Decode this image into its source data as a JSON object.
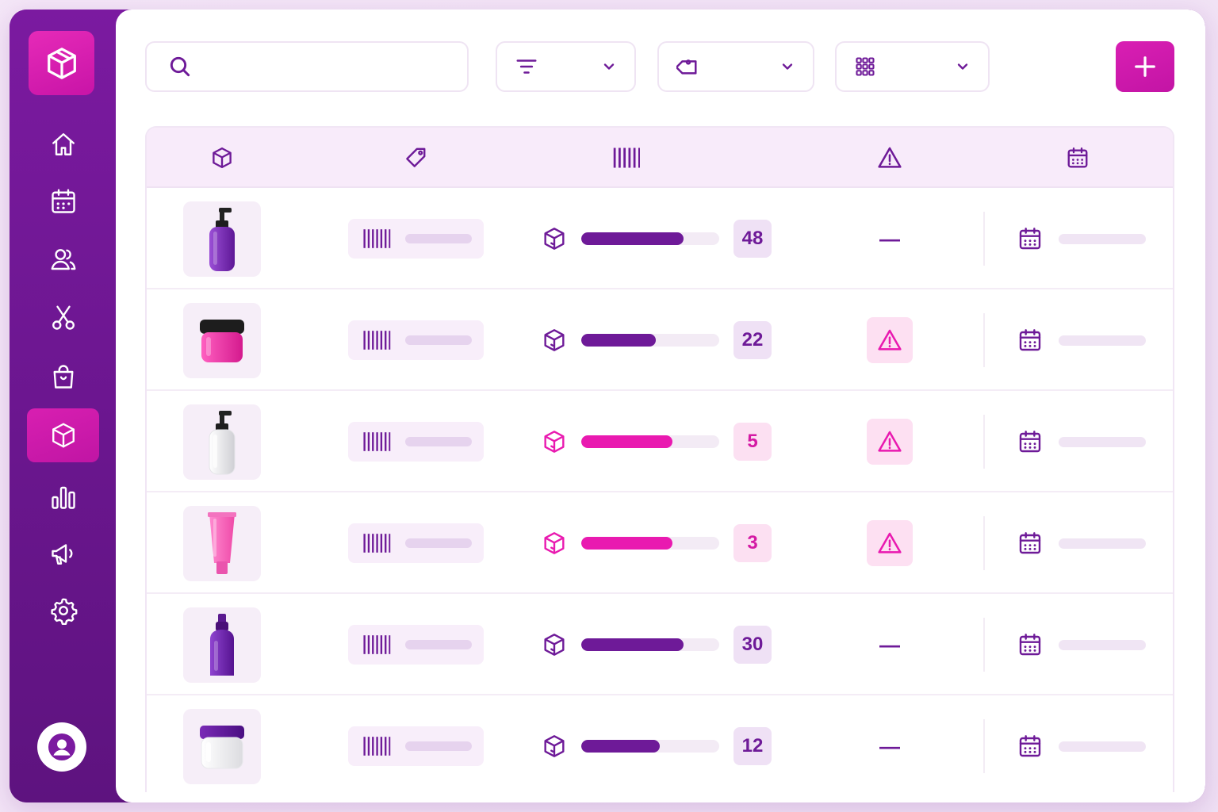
{
  "theme": {
    "primary": "#7b1aa0",
    "accent": "#d81fb1",
    "low_stock": "#e91ab0",
    "ok_stock": "#6e1a98"
  },
  "sidebar": {
    "logo_icon": "box-icon",
    "items": [
      {
        "name": "home",
        "icon": "home-icon",
        "active": false
      },
      {
        "name": "calendar",
        "icon": "calendar-icon",
        "active": false
      },
      {
        "name": "clients",
        "icon": "users-icon",
        "active": false
      },
      {
        "name": "services",
        "icon": "scissors-icon",
        "active": false
      },
      {
        "name": "shop",
        "icon": "shopping-bag-icon",
        "active": false
      },
      {
        "name": "inventory",
        "icon": "box-icon",
        "active": true
      },
      {
        "name": "reports",
        "icon": "bar-chart-icon",
        "active": false
      },
      {
        "name": "marketing",
        "icon": "megaphone-icon",
        "active": false
      },
      {
        "name": "settings",
        "icon": "gear-icon",
        "active": false
      }
    ],
    "avatar_icon": "user-icon"
  },
  "toolbar": {
    "search": {
      "value": "",
      "placeholder": "",
      "icon": "search-icon"
    },
    "filter_dropdown": {
      "icon": "filter-icon",
      "value": ""
    },
    "tag_dropdown": {
      "icon": "tag-icon",
      "value": ""
    },
    "view_dropdown": {
      "icon": "grid-icon",
      "value": ""
    },
    "add_button": {
      "icon": "plus-icon"
    }
  },
  "table": {
    "columns": [
      {
        "key": "product",
        "icon": "box-icon"
      },
      {
        "key": "tag",
        "icon": "tag-icon"
      },
      {
        "key": "barcode",
        "icon": "barcode-icon"
      },
      {
        "key": "alert",
        "icon": "warning-icon"
      },
      {
        "key": "date",
        "icon": "calendar-icon"
      }
    ],
    "rows": [
      {
        "product": "purple pump bottle",
        "thumb": "pump-bottle-purple",
        "stock": 48,
        "stock_fraction": 0.74,
        "status": "ok",
        "alert": "—"
      },
      {
        "product": "pink jar",
        "thumb": "jar-pink",
        "stock": 22,
        "stock_fraction": 0.54,
        "status": "ok",
        "alert": "warning"
      },
      {
        "product": "white pump bottle",
        "thumb": "pump-bottle-white",
        "stock": 5,
        "stock_fraction": 0.66,
        "status": "low",
        "alert": "warning"
      },
      {
        "product": "pink tube",
        "thumb": "tube-pink",
        "stock": 3,
        "stock_fraction": 0.66,
        "status": "low",
        "alert": "warning"
      },
      {
        "product": "purple spray bottle",
        "thumb": "spray-bottle-purple",
        "stock": 30,
        "stock_fraction": 0.74,
        "status": "ok",
        "alert": "—"
      },
      {
        "product": "white jar",
        "thumb": "jar-white",
        "stock": 12,
        "stock_fraction": 0.57,
        "status": "ok",
        "alert": "—"
      }
    ]
  }
}
